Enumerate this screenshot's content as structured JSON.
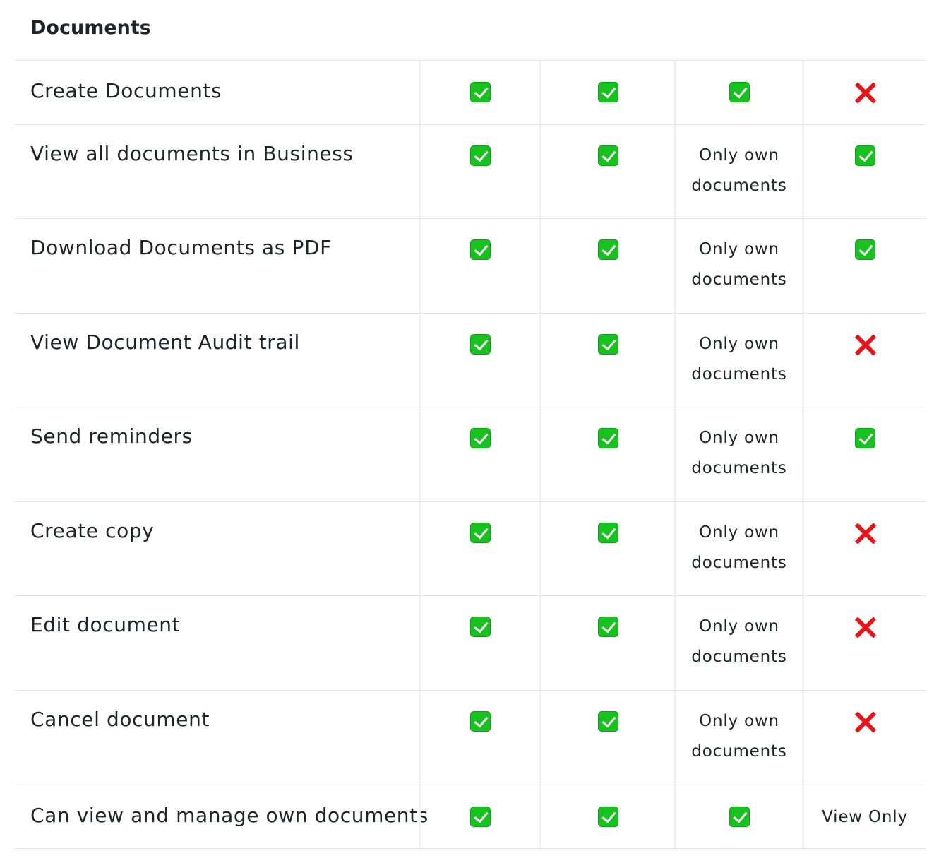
{
  "section_title": "Documents",
  "rows": [
    {
      "label": "Create Documents",
      "values": [
        {
          "type": "check",
          "icon": "green-check-icon"
        },
        {
          "type": "check",
          "icon": "green-check-icon"
        },
        {
          "type": "check",
          "icon": "green-check-icon"
        },
        {
          "type": "cross",
          "icon": "red-cross-icon"
        }
      ]
    },
    {
      "label": "View all documents in Business",
      "values": [
        {
          "type": "check",
          "icon": "green-check-icon"
        },
        {
          "type": "check",
          "icon": "green-check-icon"
        },
        {
          "type": "text",
          "text": "Only own documents"
        },
        {
          "type": "check",
          "icon": "green-check-icon"
        }
      ]
    },
    {
      "label": "Download Documents as PDF",
      "values": [
        {
          "type": "check",
          "icon": "green-check-icon"
        },
        {
          "type": "check",
          "icon": "green-check-icon"
        },
        {
          "type": "text",
          "text": "Only own documents"
        },
        {
          "type": "check",
          "icon": "green-check-icon"
        }
      ]
    },
    {
      "label": "View Document Audit trail",
      "values": [
        {
          "type": "check",
          "icon": "green-check-icon"
        },
        {
          "type": "check",
          "icon": "green-check-icon"
        },
        {
          "type": "text",
          "text": "Only own documents"
        },
        {
          "type": "cross",
          "icon": "red-cross-icon"
        }
      ]
    },
    {
      "label": "Send reminders",
      "values": [
        {
          "type": "check",
          "icon": "green-check-icon"
        },
        {
          "type": "check",
          "icon": "green-check-icon"
        },
        {
          "type": "text",
          "text": "Only own documents"
        },
        {
          "type": "check",
          "icon": "green-check-icon"
        }
      ]
    },
    {
      "label": "Create copy",
      "values": [
        {
          "type": "check",
          "icon": "green-check-icon"
        },
        {
          "type": "check",
          "icon": "green-check-icon"
        },
        {
          "type": "text",
          "text": "Only own documents"
        },
        {
          "type": "cross",
          "icon": "red-cross-icon"
        }
      ]
    },
    {
      "label": "Edit document",
      "values": [
        {
          "type": "check",
          "icon": "green-check-icon"
        },
        {
          "type": "check",
          "icon": "green-check-icon"
        },
        {
          "type": "text",
          "text": "Only own documents"
        },
        {
          "type": "cross",
          "icon": "red-cross-icon"
        }
      ]
    },
    {
      "label": "Cancel document",
      "values": [
        {
          "type": "check",
          "icon": "green-check-icon"
        },
        {
          "type": "check",
          "icon": "green-check-icon"
        },
        {
          "type": "text",
          "text": "Only own documents"
        },
        {
          "type": "cross",
          "icon": "red-cross-icon"
        }
      ]
    },
    {
      "label": "Can view and manage own documents",
      "values": [
        {
          "type": "check",
          "icon": "green-check-icon"
        },
        {
          "type": "check",
          "icon": "green-check-icon"
        },
        {
          "type": "check",
          "icon": "green-check-icon"
        },
        {
          "type": "text",
          "text": "View Only"
        }
      ]
    }
  ],
  "colors": {
    "check_green": "#17c21f",
    "cross_red": "#e8141c",
    "row_border": "#e3e3e3",
    "text": "#1f2328"
  }
}
